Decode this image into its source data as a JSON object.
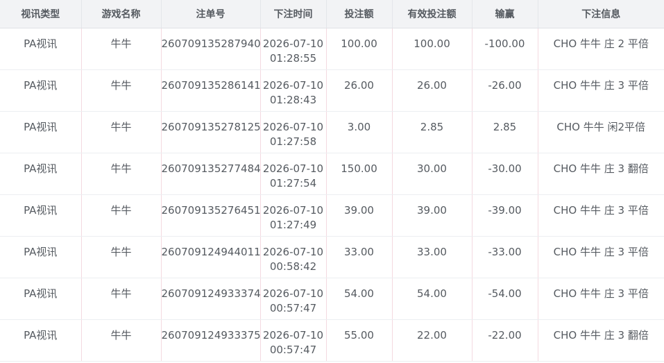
{
  "table": {
    "headers": [
      "视讯类型",
      "游戏名称",
      "注单号",
      "下注时间",
      "投注额",
      "有效投注额",
      "输赢",
      "下注信息"
    ],
    "rows": [
      {
        "type": "PA视讯",
        "game": "牛牛",
        "order_no": "260709135287940",
        "time_date": "2026-07-10",
        "time_clock": "01:28:55",
        "bet": "100.00",
        "valid_bet": "100.00",
        "win_loss": "-100.00",
        "info": "CHO 牛牛 庄 2 平倍"
      },
      {
        "type": "PA视讯",
        "game": "牛牛",
        "order_no": "260709135286141",
        "time_date": "2026-07-10",
        "time_clock": "01:28:43",
        "bet": "26.00",
        "valid_bet": "26.00",
        "win_loss": "-26.00",
        "info": "CHO 牛牛 庄 3 平倍"
      },
      {
        "type": "PA视讯",
        "game": "牛牛",
        "order_no": "260709135278125",
        "time_date": "2026-07-10",
        "time_clock": "01:27:58",
        "bet": "3.00",
        "valid_bet": "2.85",
        "win_loss": "2.85",
        "info": "CHO 牛牛 闲2平倍"
      },
      {
        "type": "PA视讯",
        "game": "牛牛",
        "order_no": "260709135277484",
        "time_date": "2026-07-10",
        "time_clock": "01:27:54",
        "bet": "150.00",
        "valid_bet": "30.00",
        "win_loss": "-30.00",
        "info": "CHO 牛牛 庄 3 翻倍"
      },
      {
        "type": "PA视讯",
        "game": "牛牛",
        "order_no": "260709135276451",
        "time_date": "2026-07-10",
        "time_clock": "01:27:49",
        "bet": "39.00",
        "valid_bet": "39.00",
        "win_loss": "-39.00",
        "info": "CHO 牛牛 庄 3 平倍"
      },
      {
        "type": "PA视讯",
        "game": "牛牛",
        "order_no": "260709124944011",
        "time_date": "2026-07-10",
        "time_clock": "00:58:42",
        "bet": "33.00",
        "valid_bet": "33.00",
        "win_loss": "-33.00",
        "info": "CHO 牛牛 庄 3 平倍"
      },
      {
        "type": "PA视讯",
        "game": "牛牛",
        "order_no": "260709124933374",
        "time_date": "2026-07-10",
        "time_clock": "00:57:47",
        "bet": "54.00",
        "valid_bet": "54.00",
        "win_loss": "-54.00",
        "info": "CHO 牛牛 庄 3 平倍"
      },
      {
        "type": "PA视讯",
        "game": "牛牛",
        "order_no": "260709124933375",
        "time_date": "2026-07-10",
        "time_clock": "00:57:47",
        "bet": "55.00",
        "valid_bet": "22.00",
        "win_loss": "-22.00",
        "info": "CHO 牛牛 庄 3 翻倍"
      }
    ]
  }
}
